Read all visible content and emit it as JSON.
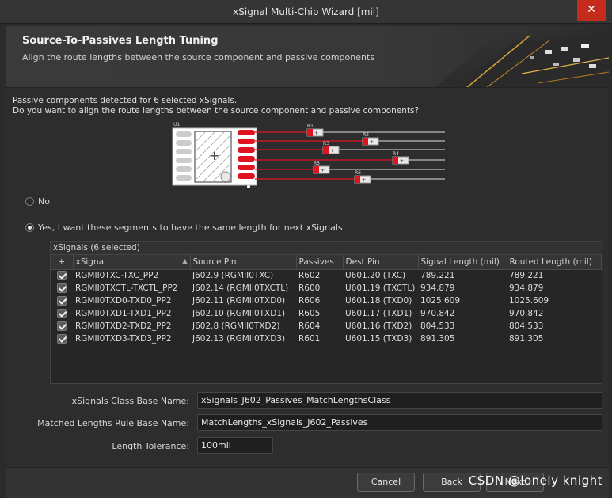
{
  "window": {
    "title": "xSignal Multi-Chip Wizard [mil]",
    "close_glyph": "✕"
  },
  "header": {
    "title": "Source-To-Passives Length Tuning",
    "subtitle": "Align the route lengths between the source component and passive components"
  },
  "intro": {
    "line1": "Passive components detected for 6 selected xSignals.",
    "line2": "Do you want to align the route lengths between the source component and passive components?"
  },
  "diagram": {
    "u_label": "U1",
    "plus": "+",
    "resistors": [
      "R1",
      "R2",
      "R3",
      "R4",
      "R5",
      "R6"
    ],
    "resistor_plus": "+"
  },
  "options": {
    "no_label": "No",
    "yes_label": "Yes, I want these segments to have the same length for next xSignals:",
    "selected": "yes"
  },
  "grid": {
    "caption": "xSignals (6 selected)",
    "columns": [
      "+",
      "xSignal",
      "Source Pin",
      "Passives",
      "Dest Pin",
      "Signal Length (mil)",
      "Routed Length (mil)"
    ],
    "sort_glyph": "▲",
    "rows": [
      {
        "checked": true,
        "xsignal": "RGMII0TXC-TXC_PP2",
        "source": "J602.9 (RGMII0TXC)",
        "passives": "R602",
        "dest": "U601.20 (TXC)",
        "signal": "789.221",
        "routed": "789.221"
      },
      {
        "checked": true,
        "xsignal": "RGMII0TXCTL-TXCTL_PP2",
        "source": "J602.14 (RGMII0TXCTL)",
        "passives": "R600",
        "dest": "U601.19 (TXCTL)",
        "signal": "934.879",
        "routed": "934.879"
      },
      {
        "checked": true,
        "xsignal": "RGMII0TXD0-TXD0_PP2",
        "source": "J602.11 (RGMII0TXD0)",
        "passives": "R606",
        "dest": "U601.18 (TXD0)",
        "signal": "1025.609",
        "routed": "1025.609"
      },
      {
        "checked": true,
        "xsignal": "RGMII0TXD1-TXD1_PP2",
        "source": "J602.10 (RGMII0TXD1)",
        "passives": "R605",
        "dest": "U601.17 (TXD1)",
        "signal": "970.842",
        "routed": "970.842"
      },
      {
        "checked": true,
        "xsignal": "RGMII0TXD2-TXD2_PP2",
        "source": "J602.8 (RGMII0TXD2)",
        "passives": "R604",
        "dest": "U601.16 (TXD2)",
        "signal": "804.533",
        "routed": "804.533"
      },
      {
        "checked": true,
        "xsignal": "RGMII0TXD3-TXD3_PP2",
        "source": "J602.13 (RGMII0TXD3)",
        "passives": "R601",
        "dest": "U601.15 (TXD3)",
        "signal": "891.305",
        "routed": "891.305"
      }
    ]
  },
  "fields": {
    "class_label": "xSignals Class Base Name:",
    "class_value": "xSignals_J602_Passives_MatchLengthsClass",
    "rule_label": "Matched Lengths Rule Base Name:",
    "rule_value": "MatchLengths_xSignals_J602_Passives",
    "tolerance_label": "Length Tolerance:",
    "tolerance_value": "100mil"
  },
  "footer": {
    "cancel": "Cancel",
    "back": "Back",
    "next": "Next"
  },
  "watermark": "CSDN @lonely knight",
  "colors": {
    "accent_red": "#e0141e",
    "background": "#2d2d2d",
    "close_red": "#c42b1c"
  }
}
